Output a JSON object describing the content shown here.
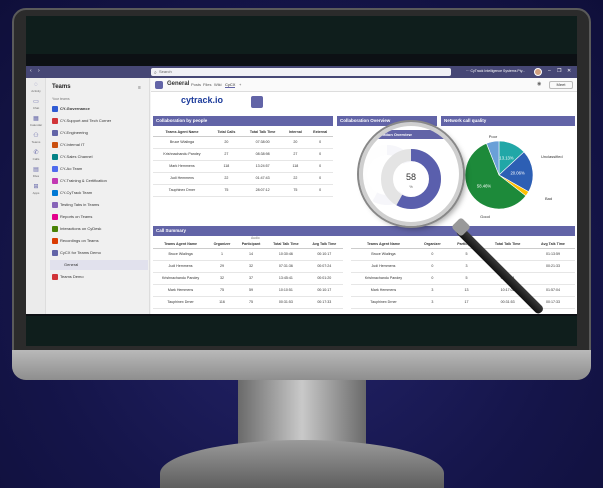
{
  "titlebar": {
    "search_placeholder": "Search",
    "org": "CyTrack Intelligence Systems Pty...",
    "controls": [
      "···",
      "–",
      "❐",
      "✕"
    ]
  },
  "rail": [
    {
      "icon": "bell-icon",
      "label": "Activity"
    },
    {
      "icon": "chat-icon",
      "label": "Chat"
    },
    {
      "icon": "calendar-icon",
      "label": "Calendar"
    },
    {
      "icon": "teams-icon",
      "label": "Teams"
    },
    {
      "icon": "calls-icon",
      "label": "Calls"
    },
    {
      "icon": "files-icon",
      "label": "Files"
    },
    {
      "icon": "apps-icon",
      "label": "Apps"
    }
  ],
  "sidebar": {
    "title": "Teams",
    "section": "Your teams",
    "items": [
      {
        "label": "CY-Governance",
        "color": "#2f5bd3",
        "bold": true
      },
      {
        "label": "CY-Support and Tech Corner",
        "color": "#d13438"
      },
      {
        "label": "CY-Engineering",
        "color": "#6264a7"
      },
      {
        "label": "CY-Internal IT",
        "color": "#ca5010"
      },
      {
        "label": "CY-Sales Channel",
        "color": "#038387"
      },
      {
        "label": "CY-Ao Team",
        "color": "#4f6bed"
      },
      {
        "label": "CY-Training & Certification",
        "color": "#c239b3"
      },
      {
        "label": "CY-CyTrack Team",
        "color": "#0078d4"
      },
      {
        "label": "Testing Tabs in Teams",
        "color": "#8764b8"
      },
      {
        "label": "Reports on Teams",
        "color": "#e3008c"
      },
      {
        "label": "Interactions on CyDesk",
        "color": "#498205"
      },
      {
        "label": "Recordings on Teams",
        "color": "#da3b01"
      },
      {
        "label": "CyCX for Teams Demo",
        "color": "#6264a7"
      },
      {
        "label": "General",
        "color": "",
        "active": true
      },
      {
        "label": "Teams Demo",
        "color": "#d13438"
      }
    ]
  },
  "header": {
    "channel": "General",
    "tabs": [
      "Posts",
      "Files",
      "Wiki",
      "CyCX",
      "+"
    ],
    "active_tab": "CyCX",
    "meet": "Meet"
  },
  "brand": {
    "logo": "cytrack.io"
  },
  "collab_people": {
    "title": "Collaboration by people",
    "columns": [
      "Teams Agent Name",
      "Total Calls",
      "Total Talk Time",
      "Internal",
      "External"
    ],
    "rows": [
      [
        "Bruce Wialinga",
        "20",
        "07:38:00",
        "20",
        "0"
      ],
      [
        "Krishnachandu Pandey",
        "27",
        "08:38:98",
        "27",
        "0"
      ],
      [
        "Mark Hemmens",
        "118",
        "13:24:57",
        "118",
        "0"
      ],
      [
        "Judi Hemmens",
        "22",
        "01:47:43",
        "22",
        "0"
      ],
      [
        "Tauphinex Drner",
        "75",
        "28:07:12",
        "75",
        "0"
      ]
    ]
  },
  "collab_overview": {
    "title": "Collaboration Overview",
    "value": "58",
    "unit": "%",
    "percent": 58,
    "accent": "#6264a7"
  },
  "network": {
    "title": "Network call quality",
    "labels": [
      "Poor",
      "Unclassified",
      "Bad",
      "Good"
    ],
    "slices": [
      {
        "name": "Poor",
        "value": 13.13,
        "label": "13.13%",
        "color": "#21a7a7"
      },
      {
        "name": "Unclassified",
        "value": 20.06,
        "label": "20.06%",
        "color": "#2d5fb4"
      },
      {
        "name": "Bad",
        "value": 2.35,
        "label": "",
        "color": "#ffc000"
      },
      {
        "name": "Good",
        "value": 58.46,
        "label": "58.46%",
        "color": "#1d8a3a"
      },
      {
        "name": "Other",
        "value": 6.0,
        "label": "",
        "color": "#6aa0d8"
      }
    ]
  },
  "call_summary": {
    "title": "Call Summary",
    "group_label": "Audio",
    "columns": [
      "Teams Agent Name",
      "Organizer",
      "Participant",
      "Total Talk Time",
      "Avg Talk Time"
    ],
    "rows": [
      [
        "Bruce Wialinga",
        "1",
        "14",
        "10:30:46",
        "00:10:17"
      ],
      [
        "Judi Hemmens",
        "29",
        "32",
        "07:31:36",
        "00:07:24"
      ],
      [
        "Krishnachandu Pandey",
        "32",
        "37",
        "13:45:41",
        "00:01:20"
      ],
      [
        "Mark Hemmens",
        "75",
        "59",
        "10:10:51",
        "00:10:17"
      ],
      [
        "Tauphinex Drner",
        "116",
        "75",
        "00:31:53",
        "00:17:33"
      ]
    ],
    "right_columns": [
      "Teams Agent Name",
      "Organizer",
      "Participant",
      "Total Talk Time",
      "Avg Talk Time"
    ],
    "right_rows": [
      [
        "Bruce Wialinga",
        "0",
        "5",
        "",
        "01:13:59"
      ],
      [
        "Judi Hemmens",
        "0",
        "3",
        "",
        "00:21:33"
      ],
      [
        "Krishnachandu Pandey",
        "0",
        "5",
        "00:30:51",
        ""
      ],
      [
        "Mark Hemmens",
        "3",
        "13",
        "10:17:02",
        "01:57:04"
      ],
      [
        "Tauphinex Drner",
        "3",
        "17",
        "00:31:53",
        "00:17:33"
      ]
    ]
  }
}
